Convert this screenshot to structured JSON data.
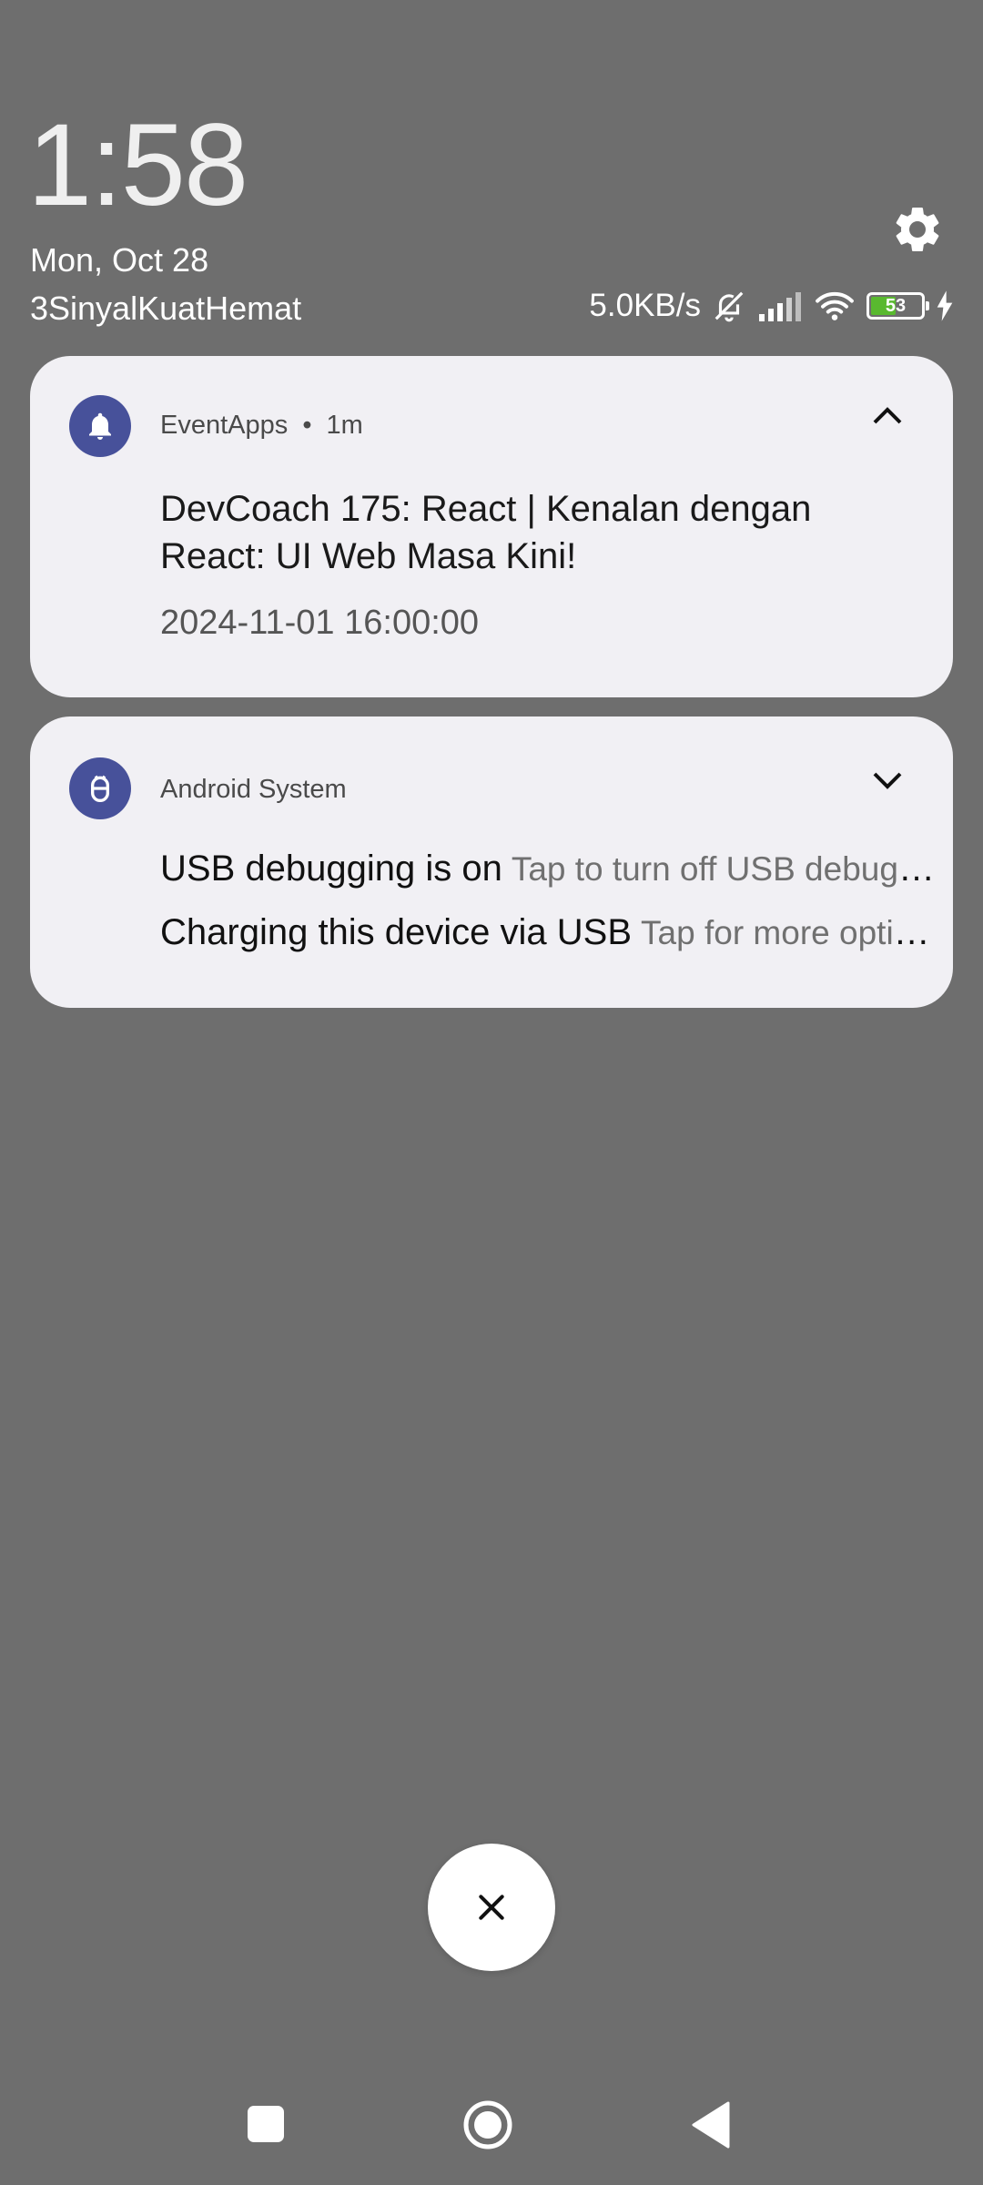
{
  "status": {
    "time": "1:58",
    "date": "Mon, Oct 28",
    "carrier": "3SinyalKuatHemat",
    "net_speed": "5.0KB/s",
    "battery_level": "53",
    "battery_fraction": 0.53
  },
  "notifications": [
    {
      "app_name": "EventApps",
      "age": "1m",
      "title": "DevCoach 175: React | Kenalan dengan React: UI Web Masa Kini!",
      "timestamp": "2024-11-01 16:00:00",
      "icon": "bell-icon",
      "expanded": true
    },
    {
      "app_name": "Android System",
      "icon": "android-icon",
      "expanded": false,
      "lines": [
        {
          "title": "USB debugging is on",
          "text": "Tap to turn off USB debugging"
        },
        {
          "title": "Charging this device via USB",
          "text": "Tap for more options."
        }
      ]
    }
  ],
  "colors": {
    "background": "#6e6e6e",
    "card": "#f1f0f4",
    "app_icon": "#47519a",
    "battery_fill": "#59b92f"
  }
}
